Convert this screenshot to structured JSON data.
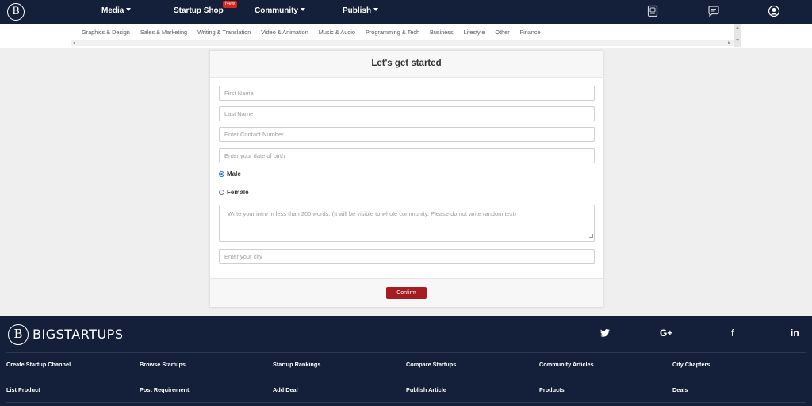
{
  "navbar": {
    "logo_letter": "B",
    "links": [
      {
        "label": "Media",
        "has_caret": true
      },
      {
        "label": "Startup Shop",
        "has_caret": false
      },
      {
        "label": "Community",
        "has_caret": true
      },
      {
        "label": "Publish",
        "has_caret": true
      }
    ],
    "new_badge": "New",
    "icons": [
      "document-icon",
      "chat-icon",
      "user-avatar-icon"
    ]
  },
  "categories": [
    "Graphics & Design",
    "Sales & Marketing",
    "Writing & Translation",
    "Video & Animation",
    "Music & Audio",
    "Programming & Tech",
    "Business",
    "Lifestyle",
    "Other",
    "Finance"
  ],
  "form": {
    "title": "Let's get started",
    "first_name_placeholder": "First Name",
    "last_name_placeholder": "Last Name",
    "contact_placeholder": "Enter Contact Number",
    "dob_placeholder": "Enter your date of birth",
    "gender_options": [
      {
        "label": "Male",
        "selected": true
      },
      {
        "label": "Female",
        "selected": false
      }
    ],
    "intro_placeholder": "Write your intro in less than 200 words. (It will be visible to whole community. Please do not write random text)",
    "city_placeholder": "Enter your city",
    "confirm_label": "Confirm"
  },
  "footer": {
    "logo_letter": "B",
    "brand": "BIGSTARTUPS",
    "social": [
      {
        "name": "twitter-icon",
        "glyph": ""
      },
      {
        "name": "google-plus-icon",
        "glyph": "G+"
      },
      {
        "name": "facebook-icon",
        "glyph": "f"
      },
      {
        "name": "linkedin-icon",
        "glyph": "in"
      }
    ],
    "links_row1": [
      "Create Startup Channel",
      "Browse Startups",
      "Startup Rankings",
      "Compare Startups",
      "Community Articles",
      "City Chapters"
    ],
    "links_row2": [
      "List Product",
      "Post Requirement",
      "Add Deal",
      "Publish Article",
      "Products",
      "Deals"
    ]
  },
  "colors": {
    "navbar_bg": "#14203a",
    "accent_red": "#a51d22",
    "badge_red": "#d9251d",
    "page_bg": "#efefef"
  }
}
